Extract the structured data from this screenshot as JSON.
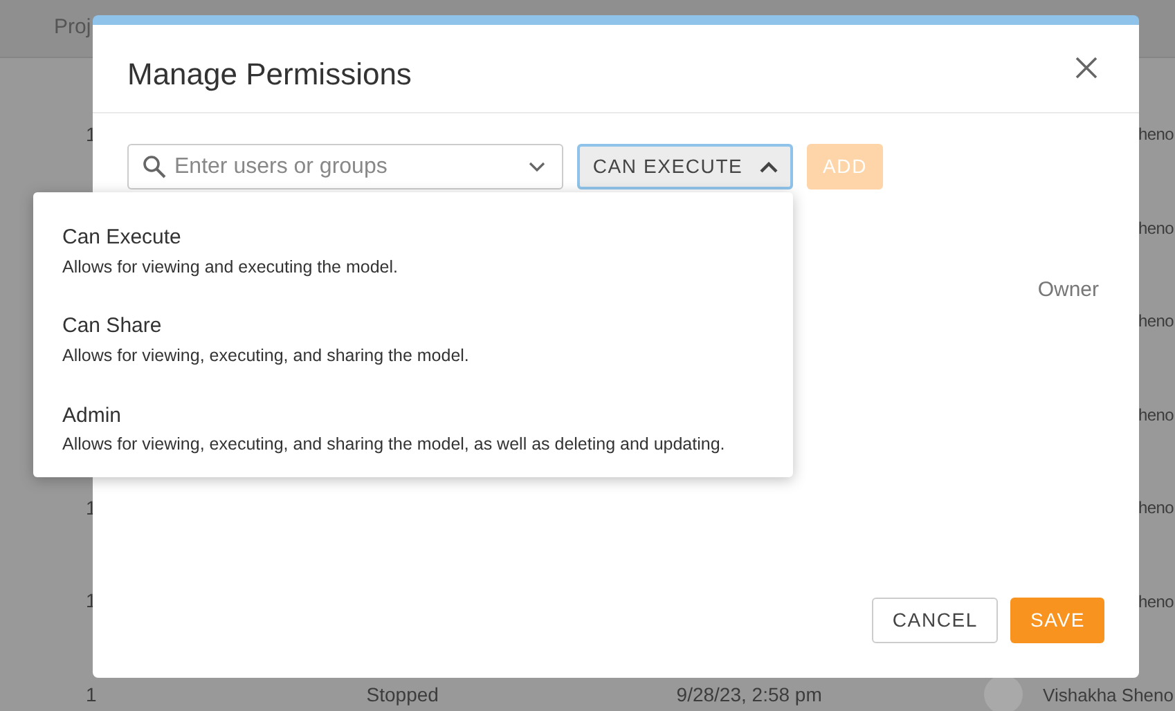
{
  "background_table": {
    "header": "Proj",
    "rows": [
      {
        "column_1": "1",
        "column_5": "heno"
      },
      {
        "column_5": "heno"
      },
      {
        "column_5": "heno"
      },
      {
        "column_5": "heno"
      },
      {
        "column_1": "1",
        "column_5": "heno"
      },
      {
        "column_1": "1",
        "column_5": "heno"
      },
      {
        "column_1": "1",
        "column_2": "Stopped",
        "column_3": "9/28/23, 2:58 pm",
        "column_5": "Vishakha Sheno"
      }
    ]
  },
  "dialog": {
    "title": "Manage Permissions",
    "search": {
      "placeholder": "Enter users or groups"
    },
    "role_button": {
      "label": "CAN EXECUTE",
      "expanded": true
    },
    "add_button": {
      "label": "ADD",
      "disabled": true
    },
    "role_menu": [
      {
        "title": "Can Execute",
        "description": "Allows for viewing and executing the model."
      },
      {
        "title": "Can Share",
        "description": "Allows for viewing, executing, and sharing the model."
      },
      {
        "title": "Admin",
        "description": "Allows for viewing, executing, and sharing the model, as well as deleting and updating."
      }
    ],
    "owner_label": "Owner",
    "buttons": [
      {
        "kind": "secondary",
        "label": "CANCEL"
      },
      {
        "kind": "primary",
        "label": "SAVE"
      }
    ]
  }
}
